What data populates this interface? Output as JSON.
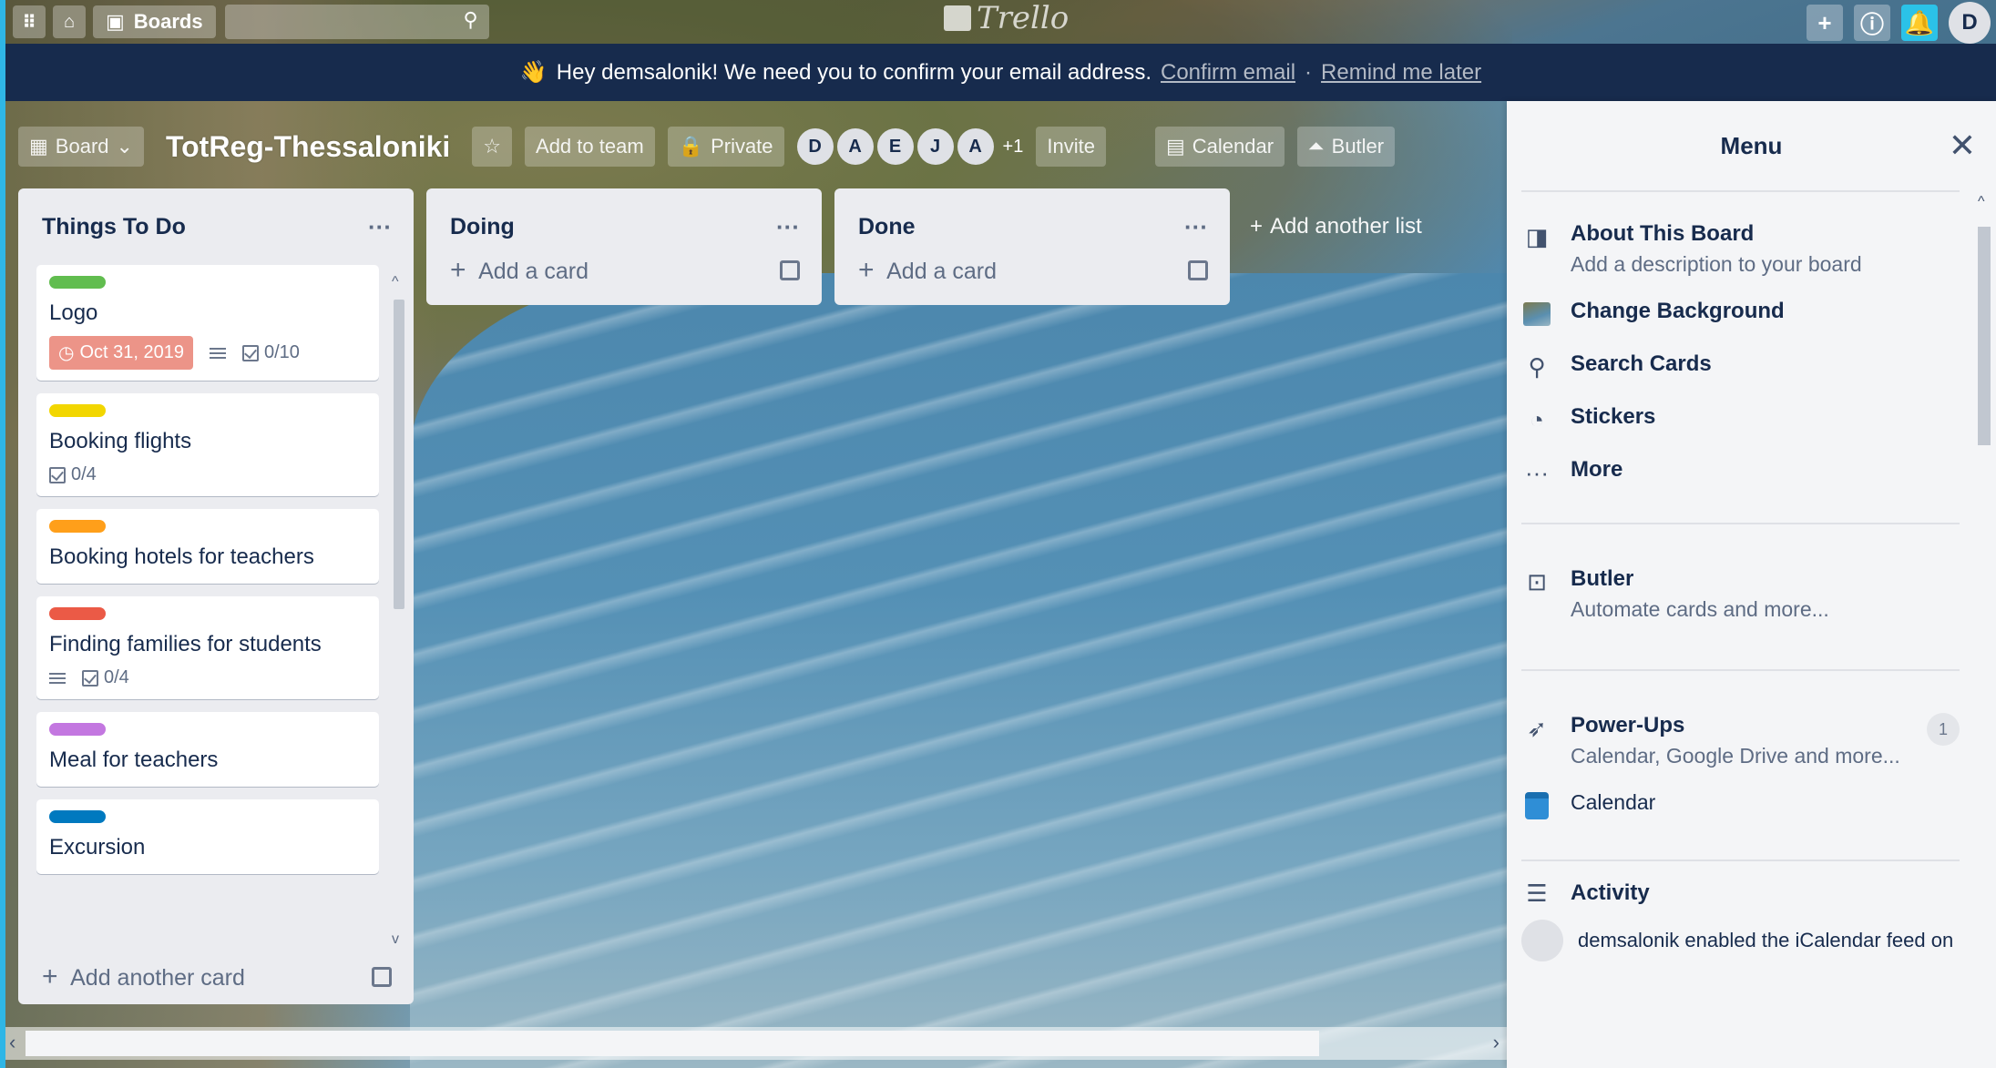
{
  "topbar": {
    "boards_label": "Boards",
    "logo_text": "Trello",
    "avatar_initial": "D"
  },
  "banner": {
    "emoji": "👋",
    "message": "Hey demsalonik! We need you to confirm your email address.",
    "confirm_link": "Confirm email",
    "separator": "·",
    "remind_link": "Remind me later"
  },
  "board_header": {
    "board_button": "Board",
    "title": "TotReg-Thessaloniki",
    "add_to_team": "Add to team",
    "visibility": "Private",
    "members": [
      "D",
      "A",
      "E",
      "J",
      "A"
    ],
    "more_members": "+1",
    "invite": "Invite",
    "calendar": "Calendar",
    "butler": "Butler"
  },
  "lists": [
    {
      "title": "Things To Do",
      "add_label": "Add another card",
      "cards": [
        {
          "title": "Logo",
          "label_color": "#61bd4f",
          "due": "Oct 31, 2019",
          "has_description": true,
          "checklist": "0/10"
        },
        {
          "title": "Booking flights",
          "label_color": "#f2d600",
          "checklist": "0/4"
        },
        {
          "title": "Booking hotels for teachers",
          "label_color": "#ff9f1a"
        },
        {
          "title": "Finding families for students",
          "label_color": "#eb5a46",
          "has_description": true,
          "checklist": "0/4"
        },
        {
          "title": "Meal for teachers",
          "label_color": "#c377e0"
        },
        {
          "title": "Excursion",
          "label_color": "#0079bf"
        }
      ]
    },
    {
      "title": "Doing",
      "add_label": "Add a card",
      "cards": []
    },
    {
      "title": "Done",
      "add_label": "Add a card",
      "cards": []
    }
  ],
  "add_another_list": "Add another list",
  "menu": {
    "title": "Menu",
    "items": [
      {
        "title": "About This Board",
        "subtitle": "Add a description to your board",
        "icon": "board-icon"
      },
      {
        "title": "Change Background",
        "icon": "background-thumbnail-icon"
      },
      {
        "title": "Search Cards",
        "icon": "search-icon"
      },
      {
        "title": "Stickers",
        "icon": "sticker-icon"
      },
      {
        "title": "More",
        "icon": "more-dots-icon"
      }
    ],
    "butler": {
      "title": "Butler",
      "subtitle": "Automate cards and more...",
      "icon": "butler-icon"
    },
    "powerups": {
      "title": "Power-Ups",
      "subtitle": "Calendar, Google Drive and more...",
      "count": "1",
      "icon": "rocket-icon"
    },
    "calendar": {
      "title": "Calendar",
      "icon": "calendar-icon"
    },
    "activity": {
      "title": "Activity",
      "icon": "activity-list-icon",
      "first_entry": "demsalonik enabled the iCalendar feed on"
    }
  },
  "colors": {
    "banner_bg": "#172b4d",
    "list_bg": "#ebecf0",
    "menu_bg": "#f4f5f7",
    "due_overdue": "#ec9488",
    "notification_accent": "#2bc2e8"
  }
}
